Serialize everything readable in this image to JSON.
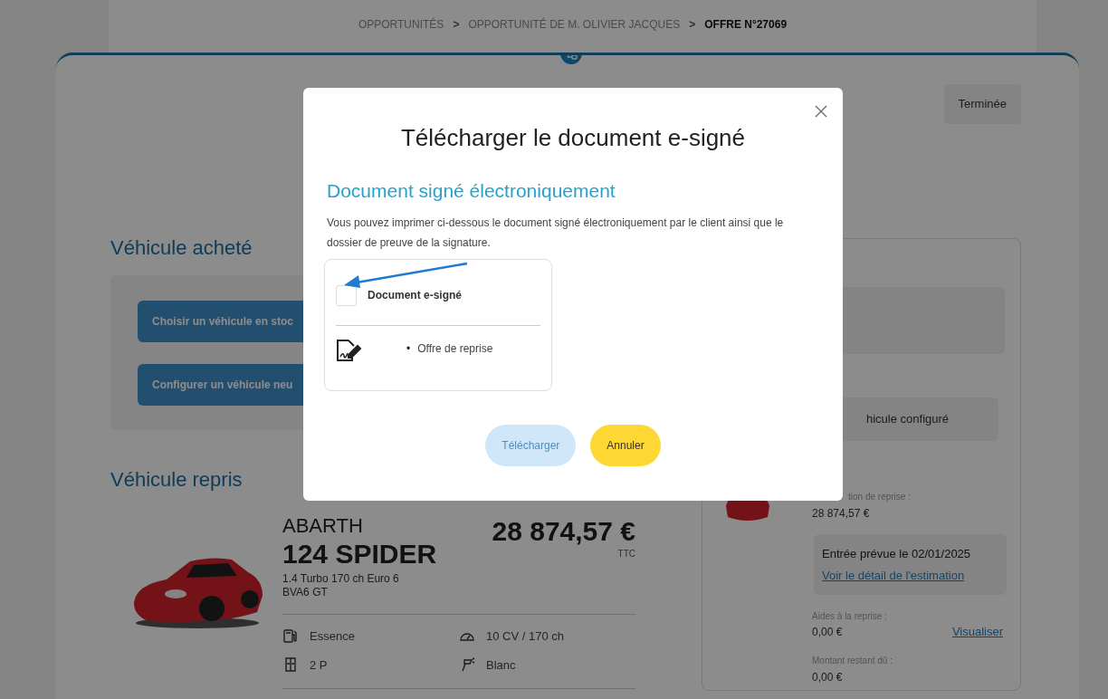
{
  "breadcrumb": [
    {
      "label": "OPPORTUNITÉS",
      "current": false
    },
    {
      "label": "OPPORTUNITÉ DE M. OLIVIER JACQUES",
      "current": false
    },
    {
      "label": "OFFRE N°27069",
      "current": true
    }
  ],
  "breadcrumb_separator": ">",
  "status_badge": "Terminée",
  "purchased_vehicle": {
    "title": "Véhicule acheté",
    "buttons": [
      "Choisir un véhicule en stoc",
      "Configurer un véhicule neu"
    ]
  },
  "trade_in_vehicle": {
    "title": "Véhicule repris",
    "make": "ABARTH",
    "model": "124 SPIDER",
    "version": "1.4 Turbo 170 ch Euro 6\nBVA6 GT",
    "price": "28 874,57 €",
    "price_note": "TTC",
    "specs": [
      {
        "kind": "fuel",
        "text": "Essence"
      },
      {
        "kind": "power",
        "text": "10 CV / 170 ch"
      },
      {
        "kind": "doors",
        "text": "2 P"
      },
      {
        "kind": "paint",
        "text": "Blanc"
      }
    ]
  },
  "summary": {
    "configured_vehicle": "hicule configuré",
    "valuation_label": "tion de reprise :",
    "valuation": "28 874,57 €",
    "entry_date": "Entrée prévue le 02/01/2025",
    "estimate_link": "Voir le détail de l'estimation",
    "aid_label": "Aides à la reprise :",
    "aid_value": "0,00 €",
    "aid_link": "Visualiser",
    "remaining_label": "Montant restant dû :",
    "remaining_value": "0,00 €"
  },
  "modal": {
    "title": "Télécharger le document e-signé",
    "section_title": "Document signé électroniquement",
    "description": "Vous pouvez imprimer ci-dessous le document signé électroniquement par le client ainsi que le dossier de preuve de la signature.",
    "document": {
      "label": "Document e-signé",
      "checked": false
    },
    "item_bullet": "•",
    "items": [
      "Offre de reprise"
    ],
    "buttons": [
      {
        "label": "Télécharger",
        "kind": "primary",
        "disabled": true
      },
      {
        "label": "Annuler",
        "kind": "secondary",
        "disabled": false
      }
    ]
  }
}
